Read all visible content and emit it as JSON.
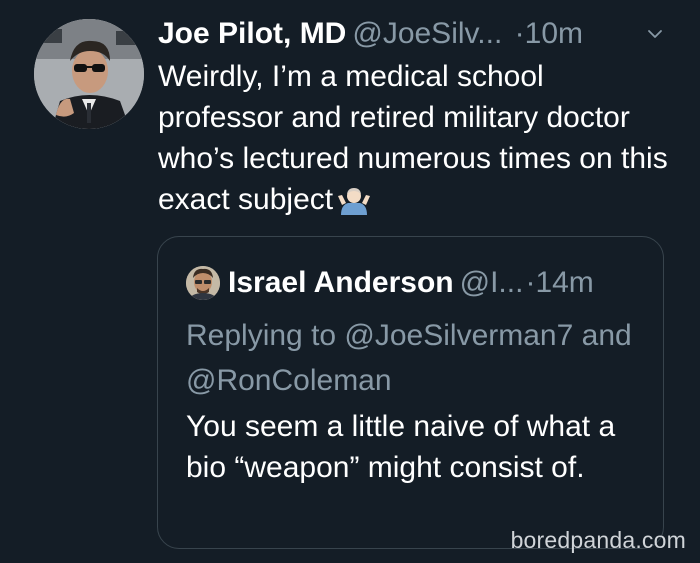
{
  "tweet": {
    "display_name": "Joe Pilot, MD",
    "handle": "@JoeSilv...",
    "separator": "·",
    "time": "10m",
    "text": "Weirdly, I’m a medical school professor and retired military doctor who’s lectured numerous times on this exact subject",
    "emoji": "shrugging-person-emoji"
  },
  "quoted_tweet": {
    "display_name": "Israel Anderson",
    "handle": "@I...",
    "separator": "·",
    "time": "14m",
    "replying_to": "Replying to @JoeSilverman7 and @RonColeman",
    "text": "You seem a little naive of what a bio “weapon” might consist of."
  },
  "watermark": "boredpanda.com",
  "colors": {
    "background": "#141d26",
    "text": "#ffffff",
    "secondary_text": "#8899a6",
    "border": "#38444d"
  }
}
